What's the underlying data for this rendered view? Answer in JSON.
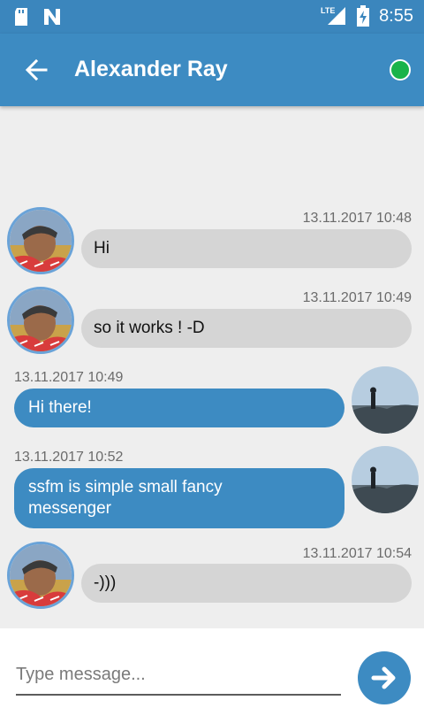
{
  "status_bar": {
    "network_label": "LTE",
    "time": "8:55"
  },
  "app_bar": {
    "title": "Alexander Ray",
    "status": "online",
    "status_color": "#19b34a",
    "accent": "#3d8bc2"
  },
  "messages": [
    {
      "direction": "incoming",
      "timestamp": "13.11.2017 10:48",
      "text": "Hi",
      "avatar": "contact-photo"
    },
    {
      "direction": "incoming",
      "timestamp": "13.11.2017 10:49",
      "text": "so it works ! -D",
      "avatar": "contact-photo"
    },
    {
      "direction": "outgoing",
      "timestamp": "13.11.2017 10:49",
      "text": "Hi there!",
      "avatar": "user-photo"
    },
    {
      "direction": "outgoing",
      "timestamp": "13.11.2017 10:52",
      "text": "ssfm is simple small fancy messenger",
      "avatar": "user-photo"
    },
    {
      "direction": "incoming",
      "timestamp": "13.11.2017 10:54",
      "text": "-)))",
      "avatar": "contact-photo"
    }
  ],
  "composer": {
    "placeholder": "Type message...",
    "value": ""
  }
}
